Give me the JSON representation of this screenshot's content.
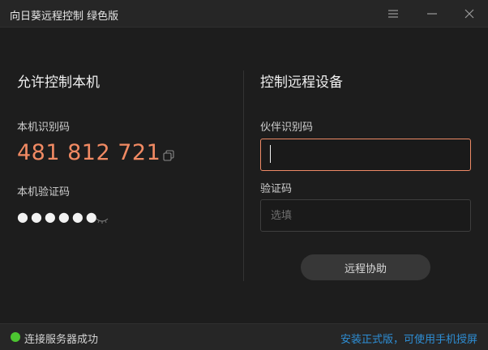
{
  "window": {
    "title": "向日葵远程控制 绿色版"
  },
  "left": {
    "title": "允许控制本机",
    "id_label": "本机识别码",
    "id_value": "481 812 721",
    "password_label": "本机验证码",
    "password_value": "●●●●●●"
  },
  "right": {
    "title": "控制远程设备",
    "partner_label": "伙伴识别码",
    "partner_value": "",
    "code_label": "验证码",
    "code_placeholder": "选填",
    "remote_button": "远程协助"
  },
  "status": {
    "text": "连接服务器成功",
    "link": "安装正式版，可使用手机授屏"
  },
  "colors": {
    "accent_orange": "#f18a63",
    "status_green": "#4cc531",
    "link_blue": "#2e8fd6"
  },
  "icons": [
    "menu-icon",
    "minimize-icon",
    "close-icon",
    "copy-icon",
    "eye-hidden-icon",
    "status-dot-icon"
  ]
}
